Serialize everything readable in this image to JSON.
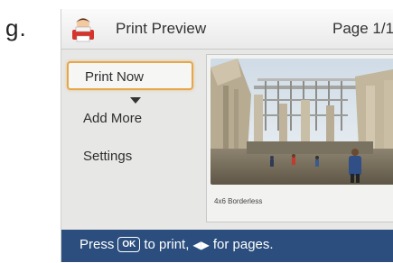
{
  "step_label": "g.",
  "header": {
    "title": "Print Preview",
    "page_indicator": "Page 1/1"
  },
  "menu": {
    "items": [
      {
        "label": "Print Now",
        "selected": true
      },
      {
        "label": "Add More",
        "selected": false
      },
      {
        "label": "Settings",
        "selected": false
      }
    ]
  },
  "preview": {
    "caption": "4x6 Borderless"
  },
  "status": {
    "prefix": "Press",
    "ok_key": "OK",
    "middle": "to print,",
    "arrows": "◀▶",
    "suffix": "for pages."
  },
  "colors": {
    "status_bar": "#2b4e7e",
    "selection_border": "#e8a64a"
  }
}
